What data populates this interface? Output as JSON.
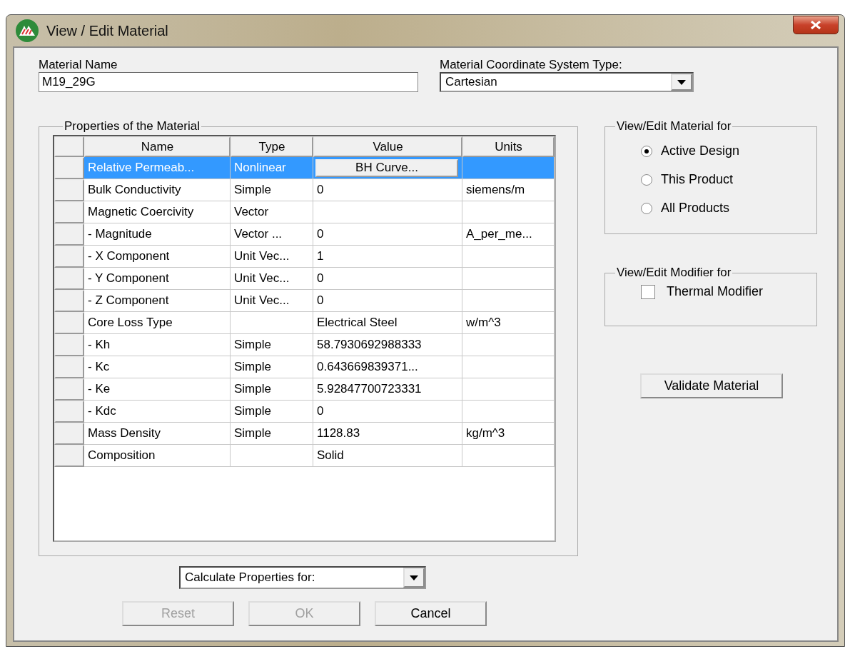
{
  "window": {
    "title": "View / Edit Material"
  },
  "material_name": {
    "label": "Material Name",
    "value": "M19_29G"
  },
  "coordinate_system": {
    "label": "Material Coordinate System Type:",
    "value": "Cartesian"
  },
  "properties": {
    "title": "Properties of the Material",
    "columns": [
      "Name",
      "Type",
      "Value",
      "Units"
    ],
    "rows": [
      {
        "name": "Relative Permeab...",
        "type": "Nonlinear",
        "value": "BH Curve...",
        "units": "",
        "kind": "button",
        "selected": true
      },
      {
        "name": "Bulk Conductivity",
        "type": "Simple",
        "value": "0",
        "units": "siemens/m",
        "kind": "text",
        "selected": false
      },
      {
        "name": "Magnetic Coercivity",
        "type": "Vector",
        "value": "",
        "units": "",
        "kind": "text",
        "selected": false
      },
      {
        "name": "-  Magnitude",
        "type": "Vector ...",
        "value": "0",
        "units": "A_per_me...",
        "kind": "text",
        "selected": false
      },
      {
        "name": "-  X Component",
        "type": "Unit Vec...",
        "value": "1",
        "units": "",
        "kind": "text",
        "selected": false
      },
      {
        "name": "-  Y Component",
        "type": "Unit Vec...",
        "value": "0",
        "units": "",
        "kind": "text",
        "selected": false
      },
      {
        "name": "-  Z Component",
        "type": "Unit Vec...",
        "value": "0",
        "units": "",
        "kind": "text",
        "selected": false
      },
      {
        "name": "Core Loss Type",
        "type": "",
        "value": "Electrical Steel",
        "units": "w/m^3",
        "kind": "text",
        "selected": false
      },
      {
        "name": "-  Kh",
        "type": "Simple",
        "value": "58.7930692988333",
        "units": "",
        "kind": "text",
        "selected": false
      },
      {
        "name": "-  Kc",
        "type": "Simple",
        "value": "0.643669839371...",
        "units": "",
        "kind": "text",
        "selected": false
      },
      {
        "name": "-  Ke",
        "type": "Simple",
        "value": "5.92847700723331",
        "units": "",
        "kind": "text",
        "selected": false
      },
      {
        "name": "-  Kdc",
        "type": "Simple",
        "value": "0",
        "units": "",
        "kind": "text",
        "selected": false
      },
      {
        "name": "Mass Density",
        "type": "Simple",
        "value": "1128.83",
        "units": "kg/m^3",
        "kind": "text",
        "selected": false
      },
      {
        "name": "Composition",
        "type": "",
        "value": "Solid",
        "units": "",
        "kind": "text",
        "selected": false
      }
    ]
  },
  "material_for": {
    "title": "View/Edit Material for",
    "options": [
      {
        "label": "Active Design",
        "selected": true
      },
      {
        "label": "This Product",
        "selected": false
      },
      {
        "label": "All Products",
        "selected": false
      }
    ]
  },
  "modifier_for": {
    "title": "View/Edit Modifier for",
    "options": [
      {
        "label": "Thermal Modifier",
        "checked": false
      }
    ]
  },
  "validate_button": {
    "label": "Validate Material"
  },
  "calculate": {
    "value": "Calculate Properties for:"
  },
  "buttons": [
    {
      "label": "Reset",
      "disabled": true
    },
    {
      "label": "OK",
      "disabled": true
    },
    {
      "label": "Cancel",
      "disabled": false
    }
  ]
}
